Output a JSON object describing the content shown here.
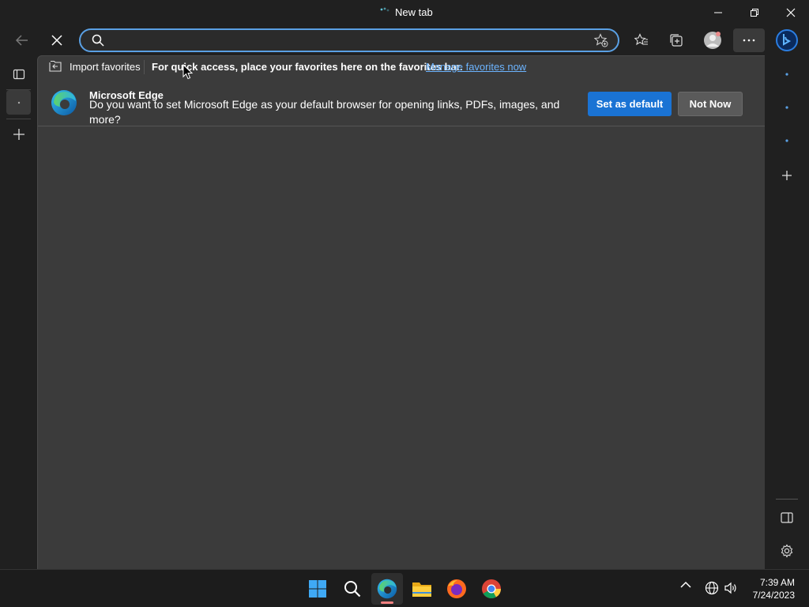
{
  "window": {
    "tab_title": "New tab"
  },
  "toolbar": {
    "address_value": "",
    "address_placeholder": ""
  },
  "favorites_bar": {
    "import_label": "Import favorites",
    "message": "For quick access, place your favorites here on the favorites bar.",
    "manage_link": "Manage favorites now"
  },
  "infobar": {
    "title": "Microsoft Edge",
    "message": "Do you want to set Microsoft Edge as your default browser for opening links, PDFs, images, and more?",
    "primary_button": "Set as default",
    "secondary_button": "Not Now"
  },
  "taskbar": {
    "time": "7:39 AM",
    "date": "7/24/2023",
    "pinned": [
      "start-icon",
      "search-icon",
      "edge-icon",
      "file-explorer-icon",
      "firefox-icon",
      "chrome-icon"
    ]
  },
  "colors": {
    "accent": "#1a73d4",
    "link": "#6cb4ff",
    "content_bg": "#3b3b3b",
    "chrome_bg": "#202020"
  }
}
